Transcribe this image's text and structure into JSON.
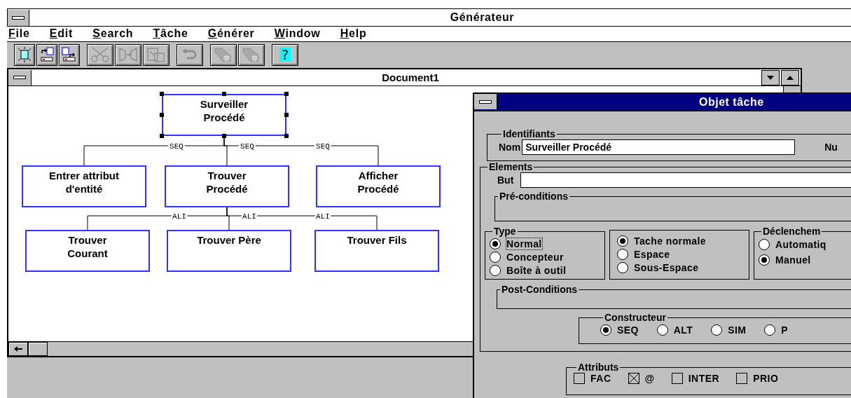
{
  "app_title": "Générateur",
  "menu": [
    "File",
    "Edit",
    "Search",
    "Tâche",
    "Générer",
    "Window",
    "Help"
  ],
  "toolbar_groups": [
    [
      {
        "kind": "new",
        "disabled": false
      },
      {
        "kind": "import",
        "disabled": false
      },
      {
        "kind": "export",
        "disabled": false
      }
    ],
    [
      {
        "kind": "cut",
        "disabled": true
      },
      {
        "kind": "split",
        "disabled": true
      },
      {
        "kind": "paste",
        "disabled": true
      }
    ],
    [
      {
        "kind": "undo",
        "disabled": true
      }
    ],
    [
      {
        "kind": "filter",
        "disabled": true
      },
      {
        "kind": "filter",
        "disabled": true
      }
    ],
    [
      {
        "kind": "help",
        "disabled": false,
        "label": "?"
      }
    ]
  ],
  "document": {
    "title": "Document1",
    "diagram": {
      "root": {
        "label": "Surveiller\nProcédé",
        "selected": true,
        "children": [
          {
            "label": "Entrer attribut\nd'entité",
            "connector": "SEQ",
            "selected": false
          },
          {
            "label": "Trouver\nProcédé",
            "connector": "SEQ",
            "selected": false,
            "children": [
              {
                "label": "Trouver\nCourant",
                "connector": "ALI",
                "selected": false
              },
              {
                "label": "Trouver Père",
                "connector": "ALI",
                "selected": false
              },
              {
                "label": "Trouver Fils",
                "connector": "ALI",
                "selected": false
              }
            ]
          },
          {
            "label": "Afficher\nProcédé",
            "connector": "SEQ",
            "selected": false
          }
        ]
      }
    }
  },
  "dialog": {
    "title": "Objet tâche",
    "identifiants": {
      "legend": "Identifiants",
      "nom_label": "Nom",
      "nom_value": "Surveiller Procédé",
      "cut_label": "Nu"
    },
    "elements": {
      "legend": "Elements",
      "but_label": "But",
      "preconditions_legend": "Pré-conditions",
      "postconditions_legend": "Post-Conditions"
    },
    "type": {
      "legend": "Type",
      "options": [
        {
          "label": "Normal",
          "selected": true,
          "focused": true
        },
        {
          "label": "Concepteur",
          "selected": false,
          "focused": false
        },
        {
          "label": "Boîte à outil",
          "selected": false,
          "focused": false
        }
      ]
    },
    "task_kind": {
      "options": [
        {
          "label": "Tache normale",
          "selected": true
        },
        {
          "label": "Espace",
          "selected": false
        },
        {
          "label": "Sous-Espace",
          "selected": false
        }
      ]
    },
    "declenchement": {
      "legend": "Déclenchem",
      "options": [
        {
          "label": "Automatiq",
          "selected": false
        },
        {
          "label": "Manuel",
          "selected": true
        }
      ]
    },
    "constructeur": {
      "legend": "Constructeur",
      "options": [
        {
          "label": "SEQ",
          "selected": true
        },
        {
          "label": "ALT",
          "selected": false
        },
        {
          "label": "SIM",
          "selected": false
        },
        {
          "label": "P",
          "selected": false
        }
      ]
    },
    "attributs": {
      "legend": "Attributs",
      "items": [
        {
          "label": "FAC",
          "checked": false
        },
        {
          "label": "@",
          "checked": true
        },
        {
          "label": "INTER",
          "checked": false
        },
        {
          "label": "PRIO",
          "checked": false
        }
      ]
    }
  }
}
